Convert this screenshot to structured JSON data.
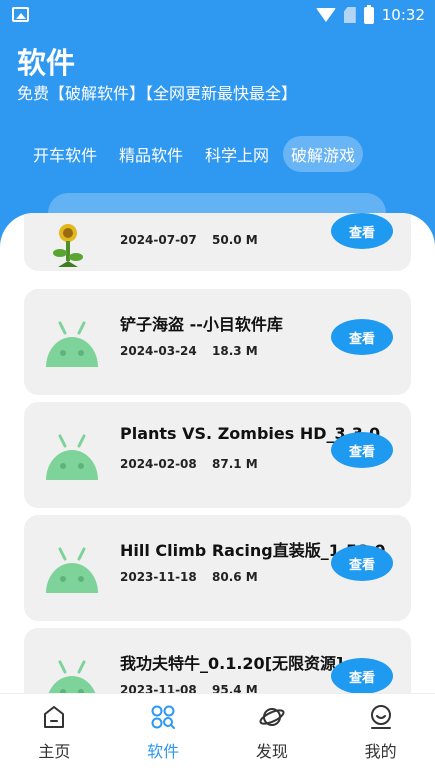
{
  "status": {
    "time": "10:32"
  },
  "header": {
    "title": "软件",
    "subtitle": "免费【破解软件】【全网更新最快最全】"
  },
  "tabs": [
    {
      "label": "开车软件"
    },
    {
      "label": "精品软件"
    },
    {
      "label": "科学上网"
    },
    {
      "label": "破解游戏"
    }
  ],
  "active_tab": 3,
  "list": [
    {
      "name": "",
      "date": "2024-07-07",
      "size": "50.0 M",
      "action": "查看",
      "icon": "sunflower-icon"
    },
    {
      "name": "铲子海盗 --小目软件库",
      "date": "2024-03-24",
      "size": "18.3 M",
      "action": "查看",
      "icon": "android-icon"
    },
    {
      "name": "Plants VS. Zombies HD_3.3.0",
      "date": "2024-02-08",
      "size": "87.1 M",
      "action": "查看",
      "icon": "android-icon"
    },
    {
      "name": "Hill Climb Racing直装版_1.58.0",
      "date": "2023-11-18",
      "size": "80.6 M",
      "action": "查看",
      "icon": "android-icon"
    },
    {
      "name": "我功夫特牛_0.1.20[无限资源]",
      "date": "2023-11-08",
      "size": "95.4 M",
      "action": "查看",
      "icon": "android-icon"
    }
  ],
  "nav": [
    {
      "label": "主页",
      "icon": "home-icon"
    },
    {
      "label": "软件",
      "icon": "apps-search-icon"
    },
    {
      "label": "发现",
      "icon": "planet-icon"
    },
    {
      "label": "我的",
      "icon": "smiley-icon"
    }
  ],
  "colors": {
    "primary": "#2f98f0",
    "card": "#f0f0f0",
    "button": "#1e9af0",
    "android": "#7ed39a"
  }
}
